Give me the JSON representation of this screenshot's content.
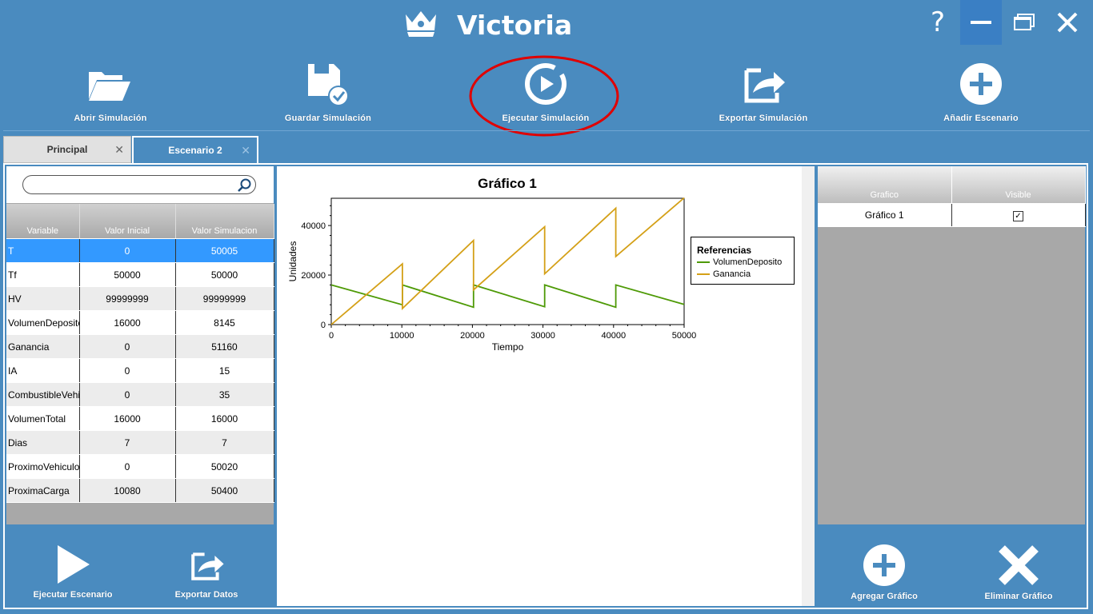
{
  "window": {
    "title": "Victoria",
    "help_label": "?"
  },
  "toolbar": {
    "open": "Abrir Simulación",
    "save": "Guardar Simulación",
    "run": "Ejecutar Simulación",
    "export": "Exportar Simulación",
    "add_scenario": "Añadir Escenario"
  },
  "tabs": [
    {
      "label": "Principal",
      "close": "✕"
    },
    {
      "label": "Escenario 2",
      "close": "✕"
    }
  ],
  "variables": {
    "search_placeholder": "",
    "headers": [
      "Variable",
      "Valor Inicial",
      "Valor Simulacion"
    ],
    "rows": [
      [
        "T",
        "0",
        "50005"
      ],
      [
        "Tf",
        "50000",
        "50000"
      ],
      [
        "HV",
        "99999999",
        "99999999"
      ],
      [
        "VolumenDeposito",
        "16000",
        "8145"
      ],
      [
        "Ganancia",
        "0",
        "51160"
      ],
      [
        "IA",
        "0",
        "15"
      ],
      [
        "CombustibleVehiculo",
        "0",
        "35"
      ],
      [
        "VolumenTotal",
        "16000",
        "16000"
      ],
      [
        "Dias",
        "7",
        "7"
      ],
      [
        "ProximoVehiculo",
        "0",
        "50020"
      ],
      [
        "ProximaCarga",
        "10080",
        "50400"
      ]
    ]
  },
  "left_buttons": {
    "run_scenario": "Ejecutar Escenario",
    "export_data": "Exportar Datos"
  },
  "chart_data": {
    "type": "line",
    "title": "Gráfico 1",
    "xlabel": "Tiempo",
    "ylabel": "Unidades",
    "xlim": [
      0,
      50000
    ],
    "ylim": [
      0,
      51000
    ],
    "xticks": [
      "0",
      "10000",
      "20000",
      "30000",
      "40000",
      "50000"
    ],
    "yticks": [
      "0",
      "20000",
      "40000"
    ],
    "legend_title": "Referencias",
    "legend_position": "right",
    "series": [
      {
        "name": "VolumenDeposito",
        "color": "#4e9a06",
        "points": [
          [
            0,
            16000
          ],
          [
            10080,
            8000
          ],
          [
            10080,
            16000
          ],
          [
            20160,
            7000
          ],
          [
            20160,
            16000
          ],
          [
            30240,
            7200
          ],
          [
            30240,
            16000
          ],
          [
            40320,
            7000
          ],
          [
            40320,
            16000
          ],
          [
            50000,
            8145
          ]
        ]
      },
      {
        "name": "Ganancia",
        "color": "#d4a017",
        "points": [
          [
            0,
            0
          ],
          [
            10080,
            24500
          ],
          [
            10080,
            6500
          ],
          [
            20160,
            34000
          ],
          [
            20160,
            14000
          ],
          [
            30240,
            39500
          ],
          [
            30240,
            20500
          ],
          [
            40320,
            47000
          ],
          [
            40320,
            27500
          ],
          [
            50000,
            51160
          ]
        ]
      }
    ]
  },
  "graphs": {
    "headers": [
      "Grafico",
      "Visible"
    ],
    "rows": [
      {
        "name": "Gráfico 1",
        "visible": true,
        "check": "✓"
      }
    ]
  },
  "right_buttons": {
    "add_graph": "Agregar Gráfico",
    "delete_graph": "Eliminar Gráfico"
  }
}
